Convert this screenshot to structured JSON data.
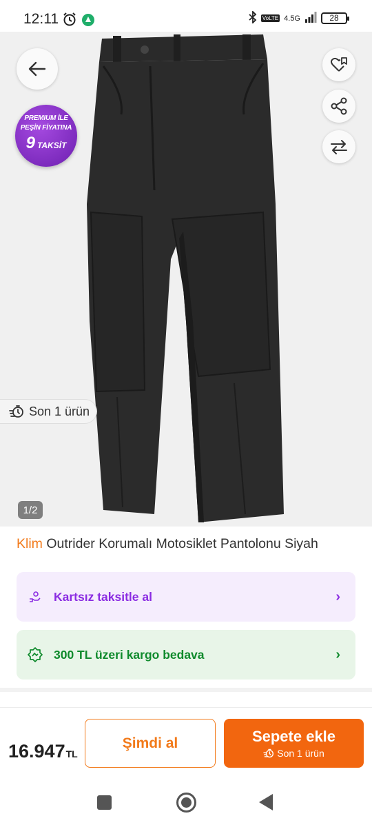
{
  "status_bar": {
    "time": "12:11",
    "network": "4.5G",
    "volte": "VoLTE",
    "battery": "28",
    "icons": [
      "alarm-icon",
      "app-notification-icon",
      "bluetooth-icon",
      "signal-icon",
      "battery-icon"
    ]
  },
  "gallery": {
    "premium_badge": {
      "line1": "PREMIUM İLE",
      "line2": "PEŞİN FİYATINA",
      "installments": "9",
      "installments_label": "TAKSİT"
    },
    "stock_label": "Son 1 ürün",
    "pager": "1/2",
    "background_color": "#f0f0f0"
  },
  "product": {
    "brand": "Klim",
    "name": "Outrider Korumalı Motosiklet Pantolonu Siyah"
  },
  "promos": [
    {
      "label": "Kartsız taksitle al",
      "icon": "hand-coin-icon",
      "color": "#8a2be2"
    },
    {
      "label": "300 TL üzeri kargo bedava",
      "icon": "badge-icon",
      "color": "#0f8a2c"
    }
  ],
  "action_bar": {
    "price": "16.947",
    "currency": "TL",
    "buy_now_label": "Şimdi al",
    "add_to_cart_label": "Sepete ekle",
    "add_to_cart_sub": "Son 1 ürün",
    "accent_color": "#f2660f"
  }
}
